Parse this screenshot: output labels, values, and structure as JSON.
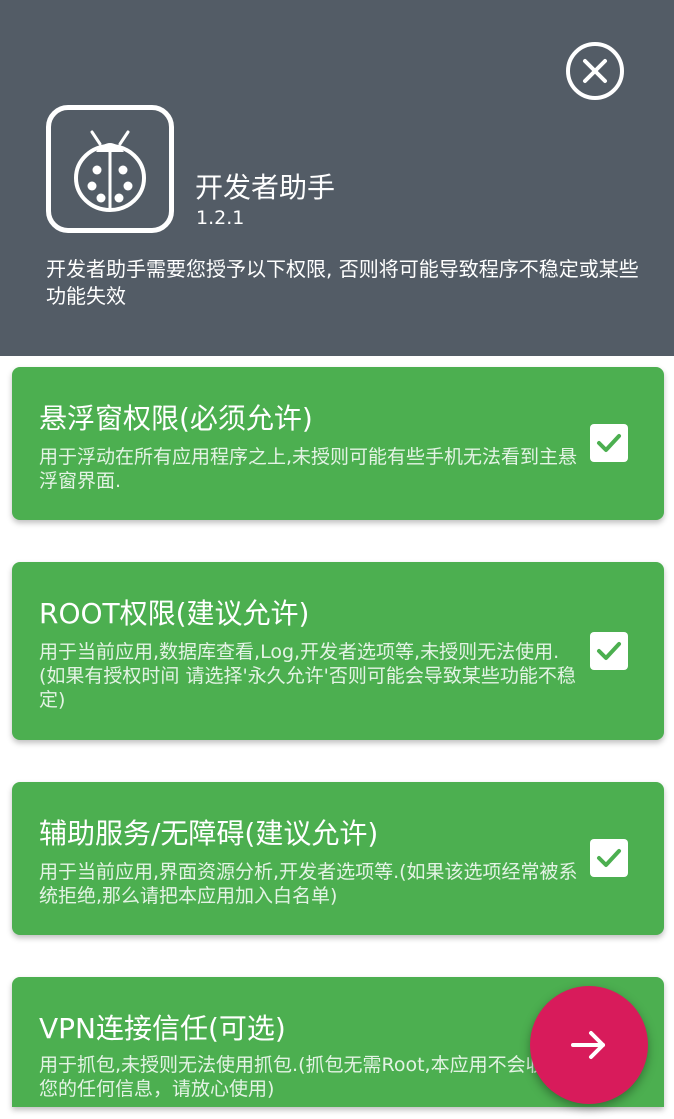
{
  "app": {
    "name": "开发者助手",
    "version": "1.2.1",
    "intro": "开发者助手需要您授予以下权限, 否则将可能导致程序不稳定或某些功能失效"
  },
  "permissions": [
    {
      "title": "悬浮窗权限(必须允许)",
      "description": "用于浮动在所有应用程序之上,未授则可能有些手机无法看到主悬浮窗界面.",
      "checked": true
    },
    {
      "title": "ROOT权限(建议允许)",
      "description": "用于当前应用,数据库查看,Log,开发者选项等,未授则无法使用.(如果有授权时间 请选择'永久允许'否则可能会导致某些功能不稳定)",
      "checked": true
    },
    {
      "title": "辅助服务/无障碍(建议允许)",
      "description": "用于当前应用,界面资源分析,开发者选项等.(如果该选项经常被系统拒绝,那么请把本应用加入白名单)",
      "checked": true
    },
    {
      "title": "VPN连接信任(可选)",
      "description": "用于抓包,未授则无法使用抓包.(抓包无需Root,本应用不会收集您的任何信息，请放心使用)",
      "checked": false
    }
  ],
  "icons": {
    "close": "close-circle-icon",
    "app": "ladybug-icon",
    "check": "check-icon",
    "next": "arrow-right-icon"
  },
  "colors": {
    "header": "#535c66",
    "card": "#4caf50",
    "fab": "#d81b5b"
  }
}
